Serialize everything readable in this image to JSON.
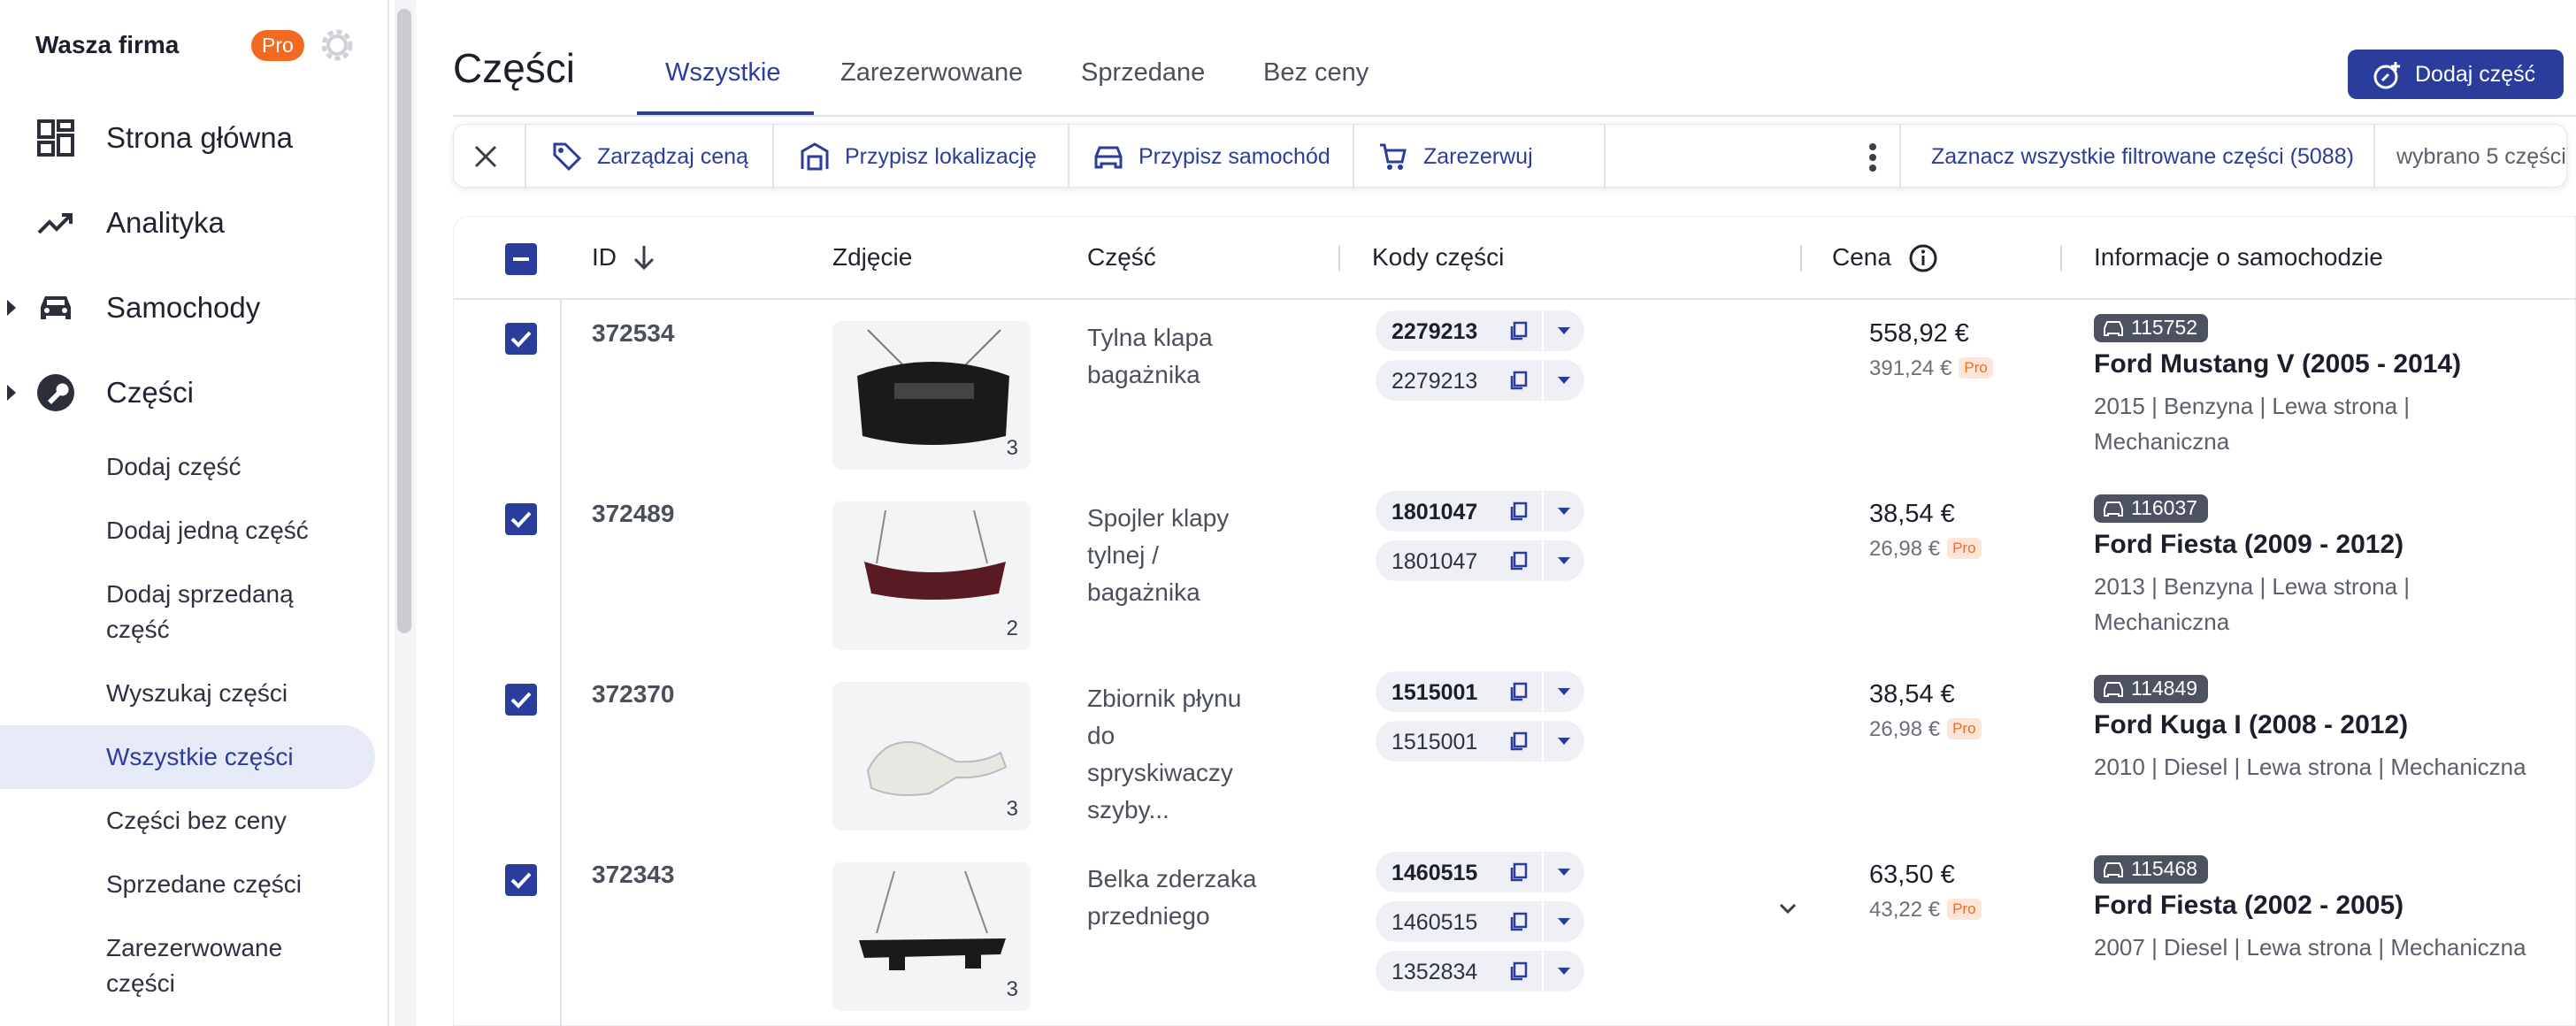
{
  "sidebar": {
    "company": "Wasza firma",
    "pro_badge": "Pro",
    "nav": [
      {
        "label": "Strona główna",
        "icon": "dashboard-icon"
      },
      {
        "label": "Analityka",
        "icon": "trending-up-icon"
      },
      {
        "label": "Samochody",
        "icon": "car-icon"
      },
      {
        "label": "Części",
        "icon": "wrench-icon"
      }
    ],
    "sub": [
      "Dodaj część",
      "Dodaj jedną część",
      "Dodaj sprzedaną część",
      "Wyszukaj części",
      "Wszystkie części",
      "Części bez ceny",
      "Sprzedane części",
      "Zarezerwowane części"
    ],
    "active_sub": "Wszystkie części"
  },
  "header": {
    "title": "Części",
    "tabs": [
      "Wszystkie",
      "Zarezerwowane",
      "Sprzedane",
      "Bez ceny"
    ],
    "active_tab": "Wszystkie",
    "add_button": "Dodaj część"
  },
  "toolbar": {
    "actions": [
      "Zarządzaj ceną",
      "Przypisz lokalizację",
      "Przypisz samochód",
      "Zarezerwuj"
    ],
    "select_all": "Zaznacz wszystkie filtrowane części (5088)",
    "selected_count": "wybrano 5 części"
  },
  "table": {
    "headers": {
      "id": "ID",
      "photo": "Zdjęcie",
      "part": "Część",
      "codes": "Kody części",
      "price": "Cena",
      "car": "Informacje o samochodzie"
    },
    "rows": [
      {
        "id": "372534",
        "photo_count": "3",
        "part_lines": [
          "Tylna klapa",
          "bagażnika"
        ],
        "codes": [
          "2279213",
          "2279213"
        ],
        "price": "558,92 €",
        "price_pro": "391,24 €",
        "pro_tag": "Pro",
        "car_id": "115752",
        "car_model": "Ford Mustang V (2005 - 2014)",
        "car_info_lines": [
          "2015 | Benzyna | Lewa strona |",
          "Mechaniczna"
        ]
      },
      {
        "id": "372489",
        "photo_count": "2",
        "part_lines": [
          "Spojler klapy",
          "tylnej /",
          "bagażnika"
        ],
        "codes": [
          "1801047",
          "1801047"
        ],
        "price": "38,54 €",
        "price_pro": "26,98 €",
        "pro_tag": "Pro",
        "car_id": "116037",
        "car_model": "Ford Fiesta (2009 - 2012)",
        "car_info_lines": [
          "2013 | Benzyna | Lewa strona |",
          "Mechaniczna"
        ]
      },
      {
        "id": "372370",
        "photo_count": "3",
        "part_lines": [
          "Zbiornik płynu",
          "do",
          "spryskiwaczy",
          "szyby..."
        ],
        "codes": [
          "1515001",
          "1515001"
        ],
        "price": "38,54 €",
        "price_pro": "26,98 €",
        "pro_tag": "Pro",
        "car_id": "114849",
        "car_model": "Ford Kuga I (2008 - 2012)",
        "car_info_lines": [
          "2010 | Diesel | Lewa strona | Mechaniczna"
        ]
      },
      {
        "id": "372343",
        "photo_count": "3",
        "part_lines": [
          "Belka zderzaka",
          "przedniego"
        ],
        "codes": [
          "1460515",
          "1460515",
          "1352834"
        ],
        "price": "63,50 €",
        "price_pro": "43,22 €",
        "pro_tag": "Pro",
        "car_id": "115468",
        "car_model": "Ford Fiesta (2002 - 2005)",
        "car_info_lines": [
          "2007 | Diesel | Lewa strona | Mechaniczna"
        ]
      }
    ]
  },
  "colors": {
    "accent": "#2a3d9d",
    "pro": "#f26a21",
    "active_bg": "#e6e9f6"
  }
}
